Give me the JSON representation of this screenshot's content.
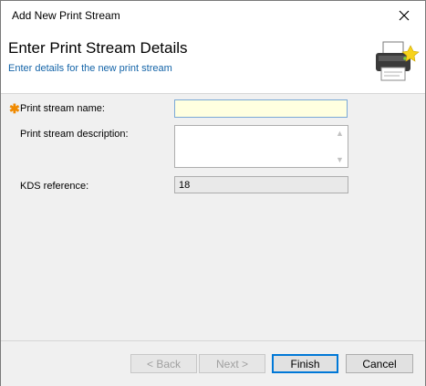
{
  "window": {
    "title": "Add New Print Stream"
  },
  "header": {
    "title": "Enter Print Stream Details",
    "subtitle": "Enter details for the new print stream"
  },
  "form": {
    "name_label": "Print stream name:",
    "name_value": "",
    "description_label": "Print stream description:",
    "description_value": "",
    "kds_label": "KDS reference:",
    "kds_value": "18"
  },
  "buttons": {
    "back": "< Back",
    "next": "Next >",
    "finish": "Finish",
    "cancel": "Cancel"
  },
  "colors": {
    "required_marker": "#f08a00",
    "subtitle": "#1464a8",
    "input_bg": "#ffffe0"
  }
}
